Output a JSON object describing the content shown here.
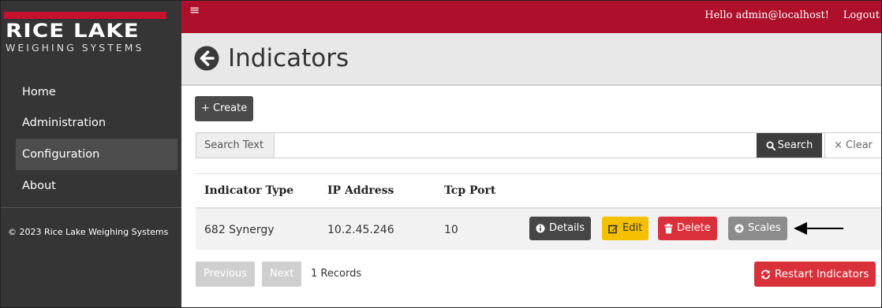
{
  "sidebar": {
    "logo_name": "RICE LAKE",
    "logo_subtitle": "WEIGHING SYSTEMS",
    "items": [
      {
        "label": "Home"
      },
      {
        "label": "Administration"
      },
      {
        "label": "Configuration",
        "active": true
      },
      {
        "label": "About"
      }
    ],
    "copyright": "© 2023 Rice Lake Weighing Systems"
  },
  "topbar": {
    "menu_icon": "≡",
    "greeting": "Hello admin@localhost!",
    "logout_label": "Logout"
  },
  "header": {
    "back_icon": "arrow-circle-left-icon",
    "title": "Indicators"
  },
  "toolbar": {
    "create_label": "+ Create"
  },
  "search": {
    "label": "Search Text",
    "value": "",
    "search_label": "Search",
    "clear_label": "Clear"
  },
  "table": {
    "columns": [
      "Indicator Type",
      "IP Address",
      "Tcp Port"
    ],
    "rows": [
      {
        "indicator_type": "682 Synergy",
        "ip_address": "10.2.45.246",
        "tcp_port": "10"
      }
    ],
    "row_actions": {
      "details_label": "Details",
      "edit_label": "Edit",
      "delete_label": "Delete",
      "scales_label": "Scales"
    }
  },
  "pagination": {
    "previous_label": "Previous",
    "next_label": "Next",
    "records_text": "1 Records"
  },
  "actions": {
    "restart_label": "Restart Indicators"
  },
  "colors": {
    "brand_red": "#ae0f2a",
    "sidebar_bg": "#353535",
    "edit_yellow": "#f5c000",
    "delete_red": "#d9303a"
  }
}
